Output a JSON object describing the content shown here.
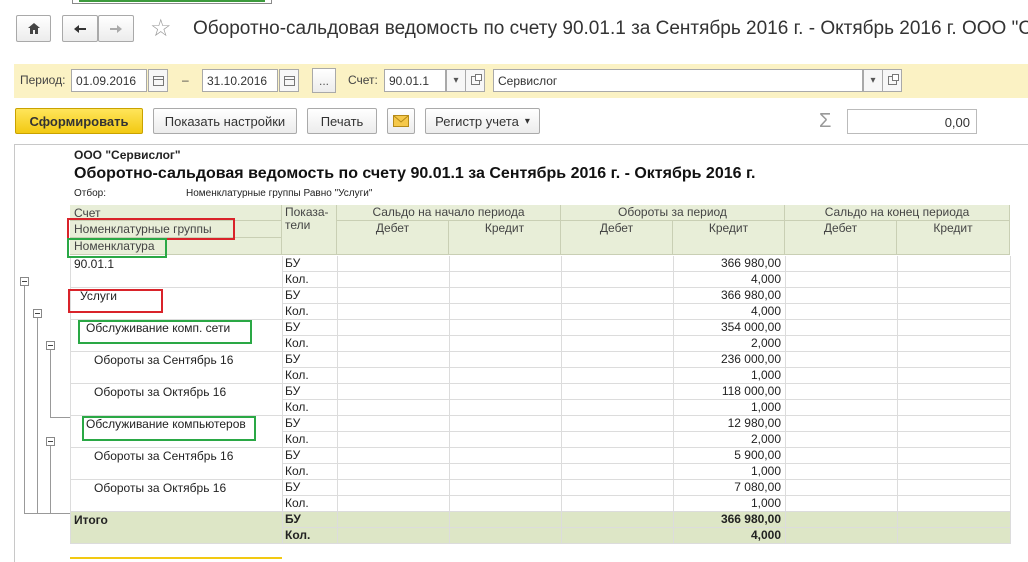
{
  "window": {
    "title": "Оборотно-сальдовая ведомость по счету 90.01.1 за Сентябрь 2016 г. - Октябрь 2016 г. ООО \"С"
  },
  "period": {
    "label": "Период:",
    "from": "01.09.2016",
    "dash": "–",
    "to": "31.10.2016",
    "more": "...",
    "account_label": "Счет:",
    "account": "90.01.1",
    "org": "Сервислог"
  },
  "toolbar": {
    "generate": "Сформировать",
    "settings": "Показать настройки",
    "print": "Печать",
    "register": "Регистр учета",
    "sum_value": "0,00"
  },
  "report": {
    "org": "ООО \"Сервислог\"",
    "title": "Оборотно-сальдовая ведомость по счету 90.01.1 за Сентябрь 2016 г. - Октябрь 2016 г.",
    "filter_label": "Отбор:",
    "filter_value": "Номенклатурные группы Равно \"Услуги\"",
    "headers": {
      "account": "Счет",
      "nomenclature_groups": "Номенклатурные группы",
      "nomenclature": "Номенклатура",
      "indicators": "Показа-\nтели",
      "opening": "Сальдо на начало периода",
      "turnover": "Обороты за период",
      "closing": "Сальдо на конец периода",
      "debit": "Дебет",
      "credit": "Кредит"
    },
    "rows": [
      {
        "name": "90.01.1",
        "ind1": "БУ",
        "val1": "366 980,00",
        "ind2": "Кол.",
        "val2": "4,000"
      },
      {
        "name": "Услуги",
        "ind1": "БУ",
        "val1": "366 980,00",
        "ind2": "Кол.",
        "val2": "4,000"
      },
      {
        "name": "Обслуживание комп. сети",
        "ind1": "БУ",
        "val1": "354 000,00",
        "ind2": "Кол.",
        "val2": "2,000"
      },
      {
        "name": "Обороты за Сентябрь 16",
        "ind1": "БУ",
        "val1": "236 000,00",
        "ind2": "Кол.",
        "val2": "1,000"
      },
      {
        "name": "Обороты за Октябрь 16",
        "ind1": "БУ",
        "val1": "118 000,00",
        "ind2": "Кол.",
        "val2": "1,000"
      },
      {
        "name": "Обслуживание компьютеров",
        "ind1": "БУ",
        "val1": "12 980,00",
        "ind2": "Кол.",
        "val2": "2,000"
      },
      {
        "name": "Обороты за Сентябрь 16",
        "ind1": "БУ",
        "val1": "5 900,00",
        "ind2": "Кол.",
        "val2": "1,000"
      },
      {
        "name": "Обороты за Октябрь 16",
        "ind1": "БУ",
        "val1": "7 080,00",
        "ind2": "Кол.",
        "val2": "1,000"
      }
    ],
    "total": {
      "name": "Итого",
      "ind1": "БУ",
      "val1": "366 980,00",
      "ind2": "Кол.",
      "val2": "4,000"
    }
  },
  "colors": {
    "accent_yellow": "#f2c912",
    "header_green": "#e8eed8",
    "total_green": "#dde6c6",
    "highlight_red": "#d9232a",
    "highlight_green": "#2aa845"
  },
  "icons": [
    "home-icon",
    "back-arrow-icon",
    "forward-arrow-icon",
    "star-icon",
    "calendar-icon",
    "dropdown-icon",
    "open-icon",
    "envelope-icon",
    "sigma-icon",
    "collapse-icon"
  ]
}
